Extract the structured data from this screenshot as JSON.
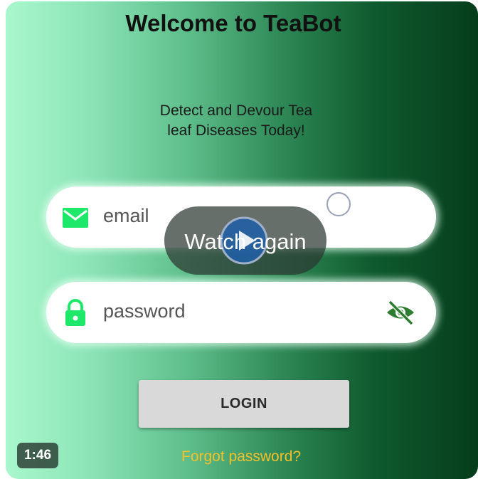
{
  "app": {
    "title": "Welcome to TeaBot",
    "subtitle_line1": "Detect and Devour Tea",
    "subtitle_line2": "leaf Diseases Today!"
  },
  "form": {
    "email_placeholder": "email",
    "password_placeholder": "password",
    "login_label": "LOGIN",
    "forgot_label": "Forgot password?"
  },
  "video": {
    "overlay_label": "Watch again",
    "duration": "1:46"
  },
  "icons": {
    "email": "mail-icon",
    "password": "lock-icon",
    "visibility": "eye-off-icon",
    "play": "play-icon"
  },
  "colors": {
    "icon_green": "#1de86a",
    "eye_green": "#2e7d32",
    "link_yellow": "#f3c12b",
    "button_gray": "#d9d9d9"
  }
}
